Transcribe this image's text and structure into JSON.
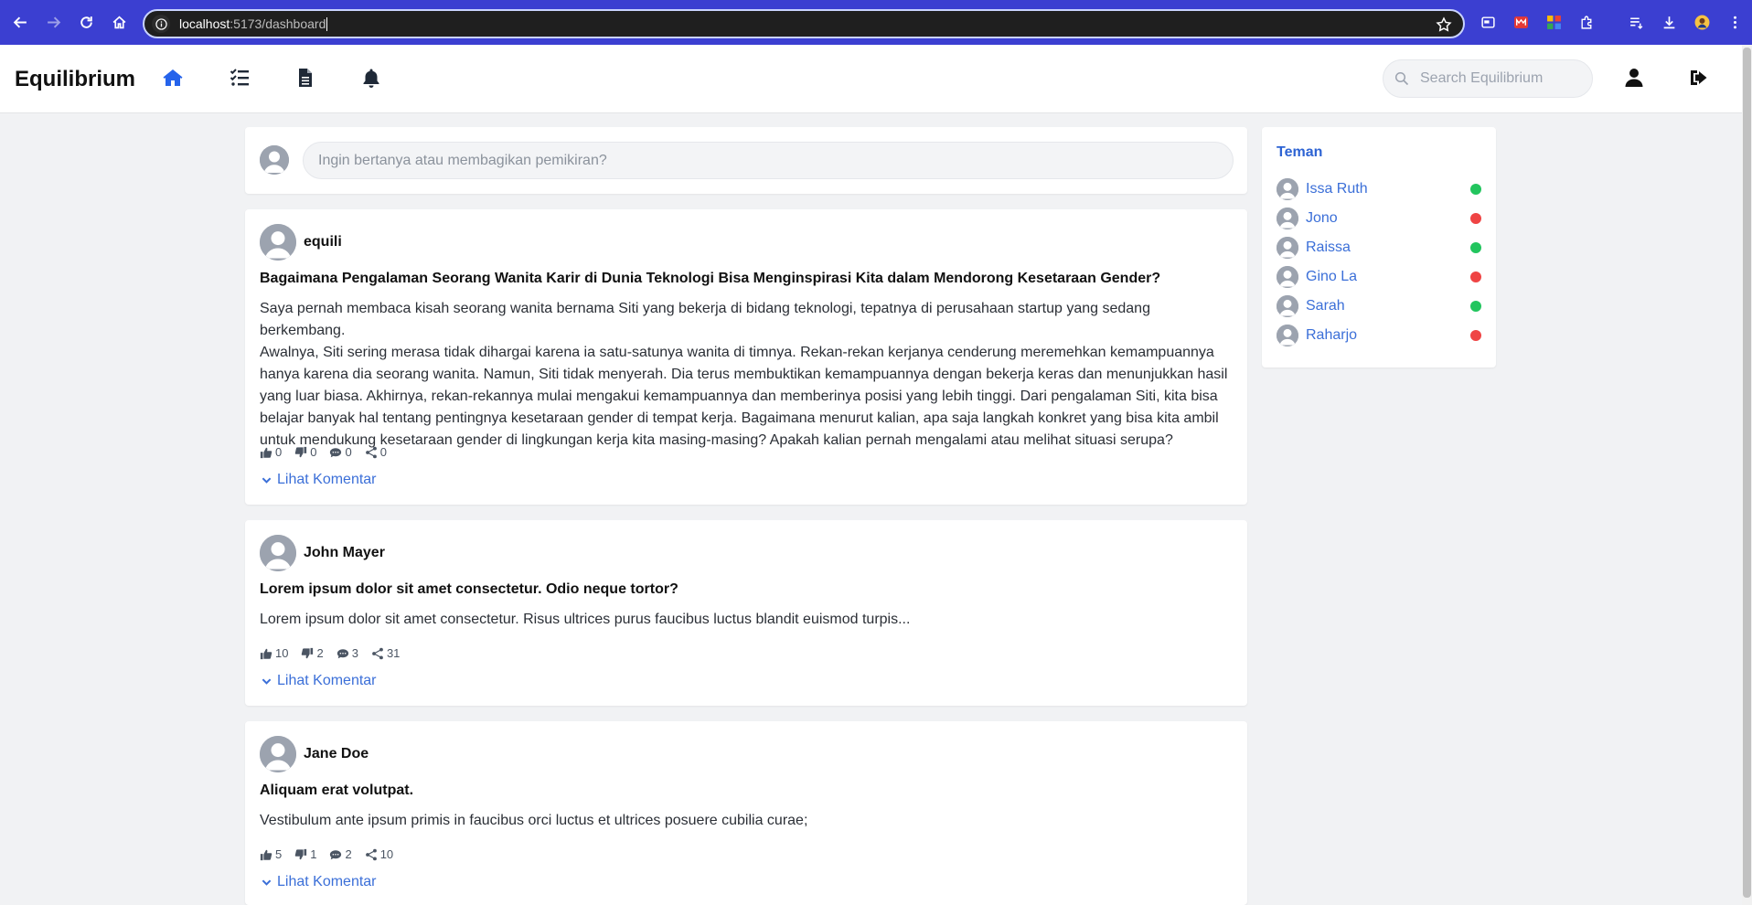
{
  "browser": {
    "url_host": "localhost",
    "url_path": ":5173/dashboard"
  },
  "app": {
    "brand": "Equilibrium",
    "search_placeholder": "Search Equilibrium",
    "accent": "#2563eb"
  },
  "composer": {
    "placeholder": "Ingin bertanya atau membagikan pemikiran?"
  },
  "posts": [
    {
      "author": "equili",
      "title": "Bagaimana Pengalaman Seorang Wanita Karir di Dunia Teknologi Bisa Menginspirasi Kita dalam Mendorong Kesetaraan Gender?",
      "lines": [
        "Saya pernah membaca kisah seorang wanita bernama Siti yang bekerja di bidang teknologi, tepatnya di perusahaan startup yang sedang berkembang.",
        "Awalnya, Siti sering merasa tidak dihargai karena ia satu-satunya wanita di timnya. Rekan-rekan kerjanya cenderung meremehkan kemampuannya",
        "hanya karena dia seorang wanita. Namun, Siti tidak menyerah. Dia terus membuktikan kemampuannya dengan bekerja keras dan menunjukkan hasil",
        "yang luar biasa. Akhirnya, rekan-rekannya mulai mengakui kemampuannya dan memberinya posisi yang lebih tinggi. Dari pengalaman Siti, kita bisa",
        "belajar banyak hal tentang pentingnya kesetaraan gender di tempat kerja. Bagaimana menurut kalian, apa saja langkah konkret yang bisa kita ambil",
        "untuk mendukung kesetaraan gender di lingkungan kerja kita masing-masing? Apakah kalian pernah mengalami atau melihat situasi serupa?"
      ],
      "likes": "0",
      "dislikes": "0",
      "comments": "0",
      "shares": "0",
      "toggle_label": "Lihat Komentar"
    },
    {
      "author": "John Mayer",
      "title": "Lorem ipsum dolor sit amet consectetur. Odio neque tortor?",
      "lines": [
        "Lorem ipsum dolor sit amet consectetur. Risus ultrices purus faucibus luctus blandit euismod turpis..."
      ],
      "likes": "10",
      "dislikes": "2",
      "comments": "3",
      "shares": "31",
      "toggle_label": "Lihat Komentar"
    },
    {
      "author": "Jane Doe",
      "title": "Aliquam erat volutpat.",
      "lines": [
        "Vestibulum ante ipsum primis in faucibus orci luctus et ultrices posuere cubilia curae;"
      ],
      "likes": "5",
      "dislikes": "1",
      "comments": "2",
      "shares": "10",
      "toggle_label": "Lihat Komentar"
    }
  ],
  "friends": {
    "title": "Teman",
    "online_color": "#22c55e",
    "offline_color": "#ef4444",
    "items": [
      {
        "name": "Issa Ruth",
        "status": "online"
      },
      {
        "name": "Jono",
        "status": "offline"
      },
      {
        "name": "Raissa",
        "status": "online"
      },
      {
        "name": "Gino La",
        "status": "offline"
      },
      {
        "name": "Sarah",
        "status": "online"
      },
      {
        "name": "Raharjo",
        "status": "offline"
      }
    ]
  }
}
